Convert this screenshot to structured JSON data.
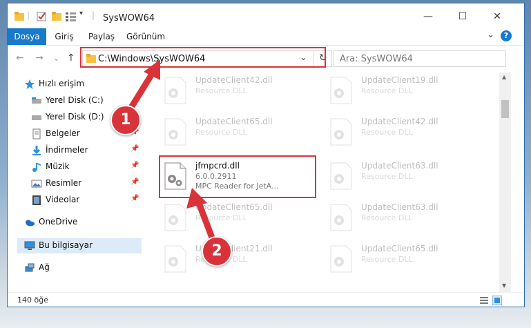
{
  "window": {
    "title": "SysWOW64",
    "minimize_glyph": "—",
    "maximize_glyph": "☐",
    "close_glyph": "✕"
  },
  "ribbon": {
    "tabs": [
      {
        "label": "Dosya"
      },
      {
        "label": "Giriş"
      },
      {
        "label": "Paylaş"
      },
      {
        "label": "Görünüm"
      }
    ],
    "expand_glyph": "⌄",
    "help_glyph": "?"
  },
  "address": {
    "path": "C:\\Windows\\SysWOW64",
    "dropdown_glyph": "⌄",
    "refresh_glyph": "↻",
    "back_glyph": "←",
    "forward_glyph": "→",
    "recent_glyph": "⌄",
    "up_glyph": "↑"
  },
  "search": {
    "placeholder": "Ara: SysWOW64",
    "icon": "search-icon"
  },
  "nav": {
    "items": [
      {
        "label": "Hızlı erişim",
        "icon": "star-icon",
        "pinned": false
      },
      {
        "label": "Yerel Disk (C:)",
        "icon": "drive-icon",
        "pinned": false
      },
      {
        "label": "Yerel Disk (D:)",
        "icon": "drive-icon",
        "pinned": false
      },
      {
        "label": "Belgeler",
        "icon": "documents-icon",
        "pinned": true
      },
      {
        "label": "İndirmeler",
        "icon": "download-icon",
        "pinned": true
      },
      {
        "label": "Müzik",
        "icon": "music-icon",
        "pinned": true
      },
      {
        "label": "Resimler",
        "icon": "pictures-icon",
        "pinned": true
      },
      {
        "label": "Videolar",
        "icon": "video-icon",
        "pinned": true
      },
      {
        "label": "OneDrive",
        "icon": "cloud-icon",
        "pinned": false
      },
      {
        "label": "Bu bilgisayar",
        "icon": "computer-icon",
        "pinned": false
      },
      {
        "label": "Ağ",
        "icon": "network-icon",
        "pinned": false
      }
    ],
    "pin_glyph": "📌"
  },
  "files": {
    "left": [
      {
        "name": "UpdateClient42.dll",
        "desc": "Resource DLL"
      },
      {
        "name": "UpdateClient65.dll",
        "desc": "Resource DLL"
      },
      {
        "name": "jfmpcrd.dll",
        "version": "6.0.0.2911",
        "desc": "MPC Reader for JetA..."
      },
      {
        "name": "UpdateClient65.dll",
        "desc": "Resource DLL"
      },
      {
        "name": "UpdateClient21.dll",
        "desc": "Resource DLL"
      }
    ],
    "right": [
      {
        "name": "UpdateClient19.dll",
        "desc": "Resource DLL"
      },
      {
        "name": "UpdateClient42.dll",
        "desc": "Resource DLL"
      },
      {
        "name": "UpdateClient63.dll",
        "desc": "Resource DLL"
      },
      {
        "name": "UpdateClient63.dll",
        "desc": "Resource DLL"
      },
      {
        "name": "UpdateClient65.dll",
        "desc": "Resource DLL"
      }
    ]
  },
  "status": {
    "count": "140 öğe"
  },
  "markers": [
    "1",
    "2"
  ],
  "colors": {
    "accent": "#1979ca",
    "highlight": "#d9333a"
  }
}
